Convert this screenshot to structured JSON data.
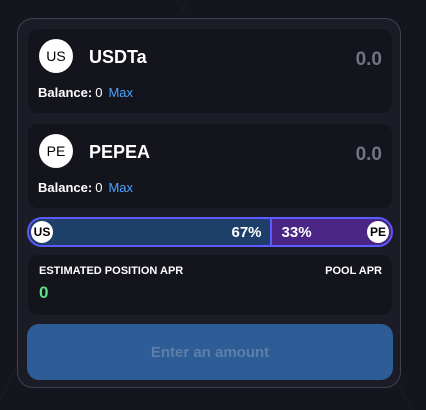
{
  "token_a": {
    "avatar": "US",
    "name": "USDTa",
    "amount_placeholder": "0.0",
    "balance_label": "Balance:",
    "balance_value": "0",
    "max_label": "Max"
  },
  "token_b": {
    "avatar": "PE",
    "name": "PEPEA",
    "amount_placeholder": "0.0",
    "balance_label": "Balance:",
    "balance_value": "0",
    "max_label": "Max"
  },
  "ratio": {
    "left_avatar": "US",
    "left_percent": "67%",
    "left_share": 0.67,
    "right_avatar": "PE",
    "right_percent": "33%",
    "right_share": 0.33
  },
  "apr": {
    "estimated_label": "ESTIMATED POSITION APR",
    "estimated_value": "0",
    "pool_label": "POOL APR"
  },
  "submit_label": "Enter an amount",
  "colors": {
    "accent": "#4aa3ff",
    "ratio_border": "#5b5bff",
    "left_fill": "#1e3f6a",
    "right_fill": "#4a2585",
    "apr_value": "#5ce08a",
    "button": "#2e5c97"
  }
}
